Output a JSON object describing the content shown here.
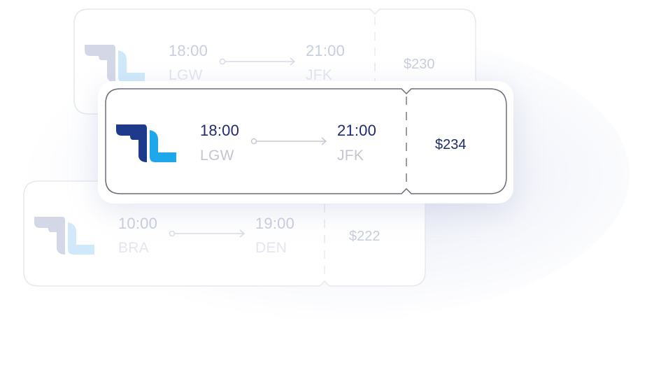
{
  "colors": {
    "brand_dark": "#1e3a8a",
    "brand_light": "#1ea7ea",
    "text_dark": "#1e2c6e",
    "text_muted": "#c3c6d1"
  },
  "tickets": [
    {
      "airline_icon": "airline-wing-logo-icon",
      "depart_time": "18:00",
      "depart_code": "LGW",
      "arrive_time": "21:00",
      "arrive_code": "JFK",
      "price": "$230",
      "state": "faded"
    },
    {
      "airline_icon": "airline-wing-logo-icon",
      "depart_time": "18:00",
      "depart_code": "LGW",
      "arrive_time": "21:00",
      "arrive_code": "JFK",
      "price": "$234",
      "state": "active"
    },
    {
      "airline_icon": "airline-wing-logo-icon",
      "depart_time": "10:00",
      "depart_code": "BRA",
      "arrive_time": "19:00",
      "arrive_code": "DEN",
      "price": "$222",
      "state": "faded"
    }
  ]
}
